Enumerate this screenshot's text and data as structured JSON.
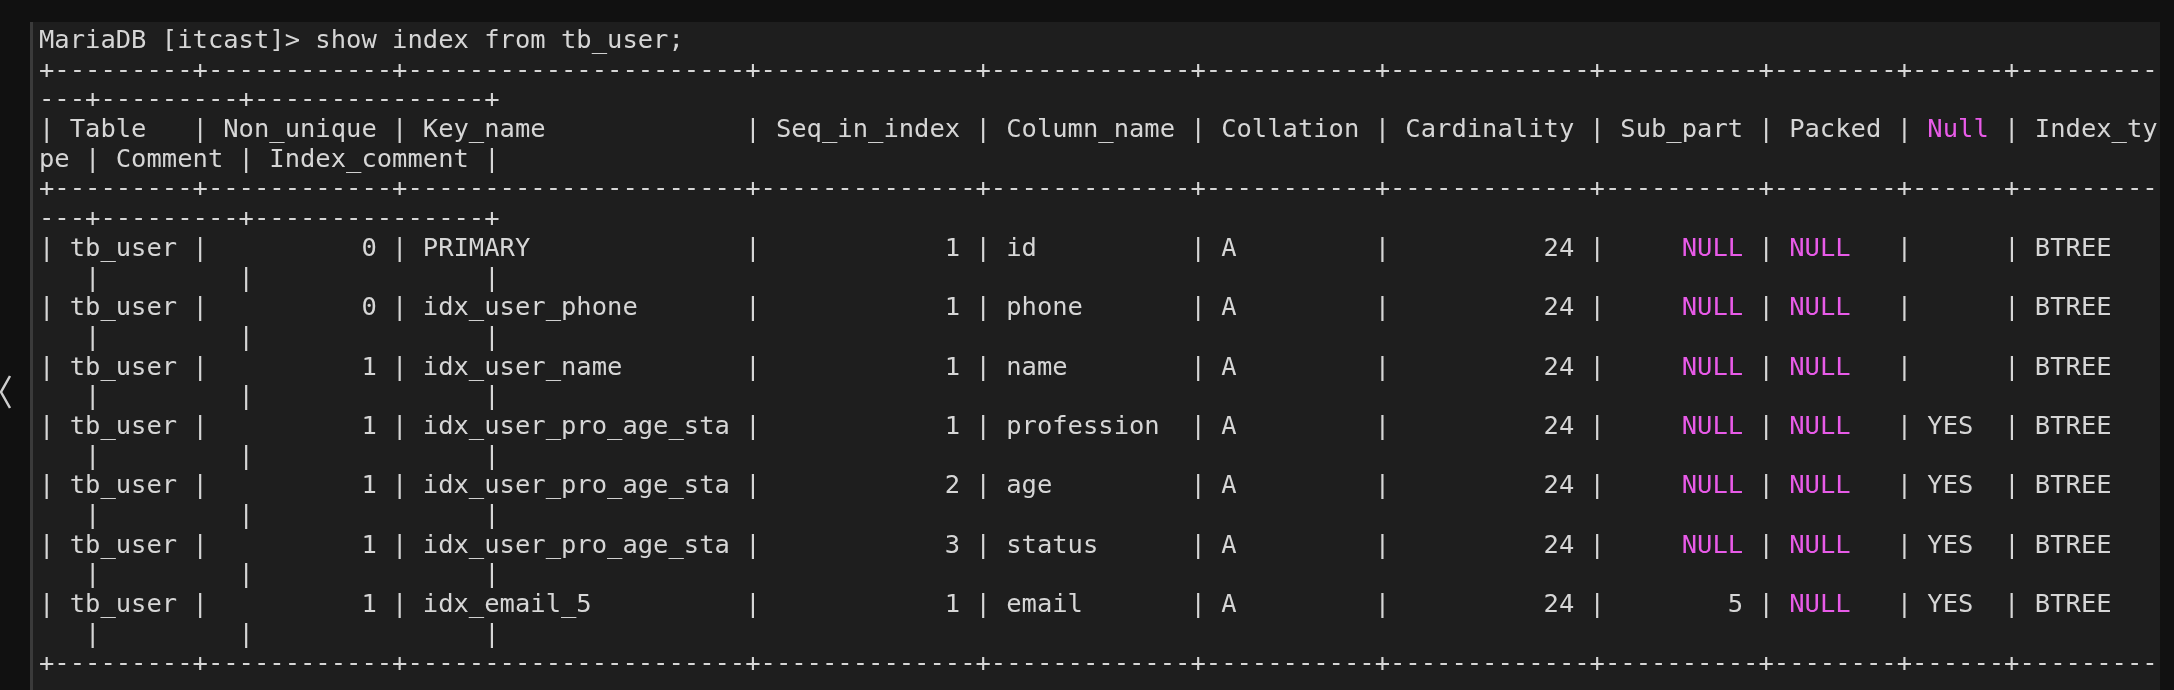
{
  "terminal": {
    "lines": [
      {
        "segments": [
          {
            "text": "MariaDB [itcast]> show index from tb_user;",
            "highlight": false
          }
        ]
      },
      {
        "segments": [
          {
            "text": "+---------+------------+----------------------+--------------+-------------+-----------+-------------+----------+--------+------+---------",
            "highlight": false
          }
        ]
      },
      {
        "segments": [
          {
            "text": "---+---------+---------------+",
            "highlight": false
          }
        ]
      },
      {
        "segments": [
          {
            "text": "| Table   | Non_unique | Key_name             | Seq_in_index | Column_name | Collation | Cardinality | Sub_part | Packed | ",
            "highlight": false
          },
          {
            "text": "Null",
            "highlight": true
          },
          {
            "text": " | Index_ty",
            "highlight": false
          }
        ]
      },
      {
        "segments": [
          {
            "text": "pe | Comment | Index_comment |",
            "highlight": false
          }
        ]
      },
      {
        "segments": [
          {
            "text": "+---------+------------+----------------------+--------------+-------------+-----------+-------------+----------+--------+------+---------",
            "highlight": false
          }
        ]
      },
      {
        "segments": [
          {
            "text": "---+---------+---------------+",
            "highlight": false
          }
        ]
      },
      {
        "segments": [
          {
            "text": "| tb_user |          0 | PRIMARY              |            1 | id          | A         |          24 |     ",
            "highlight": false
          },
          {
            "text": "NULL",
            "highlight": true
          },
          {
            "text": " | ",
            "highlight": false
          },
          {
            "text": "NULL",
            "highlight": true
          },
          {
            "text": "   |      | BTREE",
            "highlight": false
          }
        ]
      },
      {
        "segments": [
          {
            "text": "   |         |               |",
            "highlight": false
          }
        ]
      },
      {
        "segments": [
          {
            "text": "| tb_user |          0 | idx_user_phone       |            1 | phone       | A         |          24 |     ",
            "highlight": false
          },
          {
            "text": "NULL",
            "highlight": true
          },
          {
            "text": " | ",
            "highlight": false
          },
          {
            "text": "NULL",
            "highlight": true
          },
          {
            "text": "   |      | BTREE",
            "highlight": false
          }
        ]
      },
      {
        "segments": [
          {
            "text": "   |         |               |",
            "highlight": false
          }
        ]
      },
      {
        "segments": [
          {
            "text": "| tb_user |          1 | idx_user_name        |            1 | name        | A         |          24 |     ",
            "highlight": false
          },
          {
            "text": "NULL",
            "highlight": true
          },
          {
            "text": " | ",
            "highlight": false
          },
          {
            "text": "NULL",
            "highlight": true
          },
          {
            "text": "   |      | BTREE",
            "highlight": false
          }
        ]
      },
      {
        "segments": [
          {
            "text": "   |         |               |",
            "highlight": false
          }
        ]
      },
      {
        "segments": [
          {
            "text": "| tb_user |          1 | idx_user_pro_age_sta |            1 | profession  | A         |          24 |     ",
            "highlight": false
          },
          {
            "text": "NULL",
            "highlight": true
          },
          {
            "text": " | ",
            "highlight": false
          },
          {
            "text": "NULL",
            "highlight": true
          },
          {
            "text": "   | YES  | BTREE",
            "highlight": false
          }
        ]
      },
      {
        "segments": [
          {
            "text": "   |         |               |",
            "highlight": false
          }
        ]
      },
      {
        "segments": [
          {
            "text": "| tb_user |          1 | idx_user_pro_age_sta |            2 | age         | A         |          24 |     ",
            "highlight": false
          },
          {
            "text": "NULL",
            "highlight": true
          },
          {
            "text": " | ",
            "highlight": false
          },
          {
            "text": "NULL",
            "highlight": true
          },
          {
            "text": "   | YES  | BTREE",
            "highlight": false
          }
        ]
      },
      {
        "segments": [
          {
            "text": "   |         |               |",
            "highlight": false
          }
        ]
      },
      {
        "segments": [
          {
            "text": "| tb_user |          1 | idx_user_pro_age_sta |            3 | status      | A         |          24 |     ",
            "highlight": false
          },
          {
            "text": "NULL",
            "highlight": true
          },
          {
            "text": " | ",
            "highlight": false
          },
          {
            "text": "NULL",
            "highlight": true
          },
          {
            "text": "   | YES  | BTREE",
            "highlight": false
          }
        ]
      },
      {
        "segments": [
          {
            "text": "   |         |               |",
            "highlight": false
          }
        ]
      },
      {
        "segments": [
          {
            "text": "| tb_user |          1 | idx_email_5          |            1 | email       | A         |          24 |        5 | ",
            "highlight": false
          },
          {
            "text": "NULL",
            "highlight": true
          },
          {
            "text": "   | YES  | BTREE",
            "highlight": false
          }
        ]
      },
      {
        "segments": [
          {
            "text": "   |         |               |",
            "highlight": false
          }
        ]
      },
      {
        "segments": [
          {
            "text": "+---------+------------+----------------------+--------------+-------------+-----------+-------------+----------+--------+------+---------",
            "highlight": false
          }
        ]
      }
    ]
  }
}
